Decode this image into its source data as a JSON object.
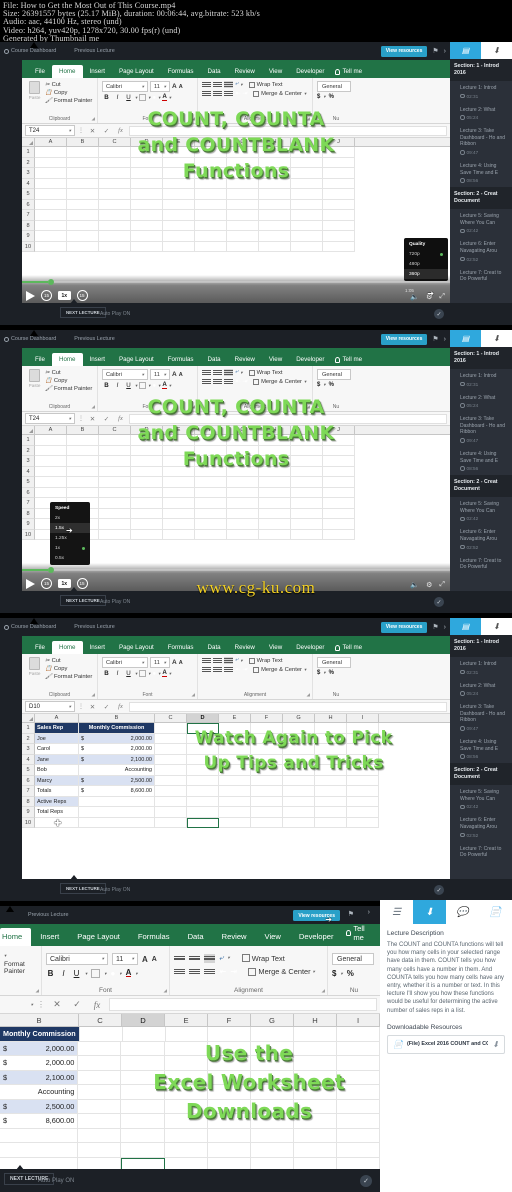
{
  "meta": {
    "lines": [
      "File: How to Get the Most Out of This Course.mp4",
      "Size: 26391557 bytes (25.17 MiB), duration: 00:06:44, avg.bitrate: 523 kb/s",
      "Audio: aac, 44100 Hz, stereo (und)",
      "Video: h264, yuv420p, 1278x720, 30.00 fps(r) (und)",
      "Generated by Thumbnail me"
    ]
  },
  "player": {
    "dashboard_label": "Course Dashboard",
    "previous_lecture_label": "Previous Lecture",
    "view_resources_label": "View resources",
    "flag_icon": "flag-icon",
    "chevron_icon": "chevron-right-icon",
    "next_lecture_label": "NEXT LECTURE",
    "autoplay_label": "Auto Play ON",
    "rewind_label": "15",
    "forward_label": "15",
    "speed_label": "1x",
    "time_remaining": "1:05",
    "quality_menu": {
      "title": "Quality",
      "options": [
        "720p",
        "480p",
        "360p"
      ],
      "selected": "720p",
      "hovered": "360p"
    },
    "speed_menu": {
      "title": "Speed",
      "options": [
        "2x",
        "1.5x",
        "1.25x",
        "1x",
        "0.5x"
      ],
      "selected": "1x",
      "hovered": "1.5x"
    }
  },
  "excel": {
    "tabs": [
      "File",
      "Home",
      "Insert",
      "Page Layout",
      "Formulas",
      "Data",
      "Review",
      "View",
      "Developer"
    ],
    "active_tab": "Home",
    "tell_me": "Tell me",
    "clipboard": {
      "group_label": "Clipboard",
      "paste": "Paste",
      "cut": "Cut",
      "copy": "Copy",
      "format_painter": "Format Painter"
    },
    "font": {
      "group_label": "Font",
      "family": "Calibri",
      "size": "11",
      "grow": "A",
      "shrink": "A",
      "bold": "B",
      "italic": "I",
      "underline": "U",
      "font_color": "A"
    },
    "alignment": {
      "group_label": "Alignment",
      "wrap_text": "Wrap Text",
      "merge_center": "Merge & Center"
    },
    "number": {
      "group_label": "Nu",
      "format": "General",
      "currency": "$",
      "percent": "%"
    },
    "formula_bar": {
      "name_box_f1": "T24",
      "name_box_f2": "T24",
      "name_box_f3": "D10",
      "cancel_icon": "cancel-icon",
      "confirm_icon": "confirm-icon",
      "function_icon": "fx",
      "value": ""
    },
    "columns": [
      "A",
      "B",
      "C",
      "D",
      "E",
      "F",
      "G",
      "H",
      "I",
      "J"
    ],
    "columns_zoom": [
      "B",
      "C",
      "D",
      "E",
      "F",
      "G",
      "H",
      "I"
    ],
    "rows": [
      "1",
      "2",
      "3",
      "4",
      "5",
      "6",
      "7",
      "8",
      "9",
      "10"
    ],
    "selected_column_f3": "D",
    "selected_column_f4": "D",
    "sheet": {
      "headers": [
        "Sales Rep",
        "Monthly Commission"
      ],
      "rows": [
        {
          "rep": "Joe",
          "cur": "$",
          "amt": "2,000.00"
        },
        {
          "rep": "Carol",
          "cur": "$",
          "amt": "2,000.00"
        },
        {
          "rep": "Jane",
          "cur": "$",
          "amt": "2,100.00"
        },
        {
          "rep": "Bob",
          "cur": "",
          "amt": "Accounting"
        },
        {
          "rep": "Marcy",
          "cur": "$",
          "amt": "2,500.00"
        },
        {
          "rep": "Totals",
          "cur": "$",
          "amt": "8,600.00"
        },
        {
          "rep": "Active Reps",
          "cur": "",
          "amt": ""
        },
        {
          "rep": "Total Reps",
          "cur": "",
          "amt": ""
        }
      ]
    }
  },
  "overlays": {
    "frame1": [
      "COUNT, COUNTA",
      "and COUNTBLANK",
      "Functions"
    ],
    "frame2": [
      "COUNT, COUNTA",
      "and COUNTBLANK",
      "Functions"
    ],
    "frame3": [
      "Watch Again to Pick",
      "Up Tips and Tricks"
    ],
    "frame4": [
      "Use the",
      "Excel Worksheet",
      "Downloads"
    ],
    "accent_green": "#7ed957"
  },
  "watermark": "www.cg-ku.com",
  "sidebar": {
    "tabs": [
      {
        "name": "content-tab",
        "icon": "list-icon"
      },
      {
        "name": "downloads-tab",
        "icon": "download-icon"
      }
    ],
    "active_tab": "content-tab",
    "sections": [
      {
        "title": "Section: 1 - Introd 2016",
        "lectures": [
          {
            "title": "Lecture 1: Introd",
            "duration": "02:31"
          },
          {
            "title": "Lecture 2: What",
            "duration": "05:24"
          },
          {
            "title": "Lecture 3: Take Dashboard - Ho and Ribbon",
            "duration": "09:47"
          },
          {
            "title": "Lecture 4: Using Save Time and E",
            "duration": "08:56"
          }
        ]
      },
      {
        "title": "Section: 2 - Creat Document",
        "lectures": [
          {
            "title": "Lecture 5: Saving Where You Can",
            "duration": "02:42"
          },
          {
            "title": "Lecture 6: Enter Navagating Arou",
            "duration": "02:52"
          },
          {
            "title": "Lecture 7: Creat to Do Powerful",
            "duration": ""
          }
        ]
      }
    ]
  },
  "description_panel": {
    "tabs": [
      {
        "name": "overview-tab",
        "icon": "list-icon"
      },
      {
        "name": "resources-tab",
        "icon": "download-icon"
      },
      {
        "name": "discussion-tab",
        "icon": "chat-icon"
      },
      {
        "name": "notes-tab",
        "icon": "document-icon"
      }
    ],
    "active_tab": "resources-tab",
    "heading": "Lecture Description",
    "body": "The COUNT and COUNTA functions will tell you how many cells in your selected range have data in them. COUNT tells you how many cells have a number in them. And COUNTA tells you how many cells have any entry, whether it is a number or text. In this lecture I'll show you how these functions would be useful for determining the active number of sales reps in a list.",
    "resources_heading": "Downloadable Resources",
    "file_label": "(File) Excel 2016 COUNT and CO...",
    "file_icon": "document-icon",
    "download_icon": "download-icon"
  }
}
